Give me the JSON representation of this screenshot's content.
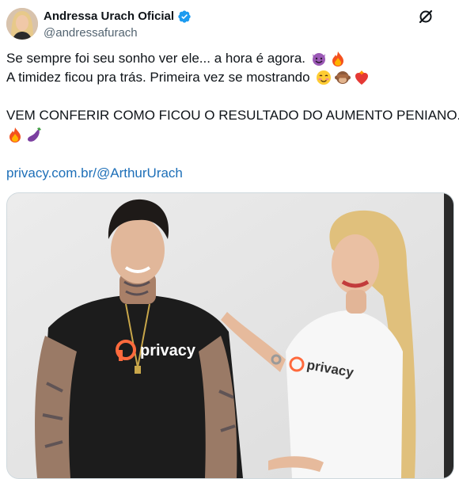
{
  "author": {
    "display_name": "Andressa Urach Oficial",
    "handle": "@andressafurach",
    "verified_icon": "verified-badge-icon",
    "avatar_icon": "avatar-photo"
  },
  "menu_icon": "grok-slash-icon",
  "tweet": {
    "line1": "Se sempre foi seu sonho ver ele... a hora é agora.",
    "line2": "A timidez ficou pra trás. Primeira vez se mostrando",
    "line3": "VEM CONFERIR COMO FICOU O RESULTADO DO AUMENTO PENIANO.",
    "link": "privacy.com.br/@ArthurUrach",
    "line1_emojis": [
      "smiling-devil-emoji",
      "fire-emoji"
    ],
    "line2_emojis": [
      "smiling-blush-emoji",
      "see-no-evil-monkey-emoji",
      "heart-on-fire-emoji"
    ],
    "line3_emojis": [
      "fire-emoji",
      "eggplant-emoji"
    ]
  },
  "media": {
    "shirt_left": "privacy",
    "shirt_right": "privacy",
    "accent": "#ff6a3d"
  },
  "colors": {
    "verified": "#1d9bf0",
    "link": "#1d6fb8",
    "handle": "#536471"
  }
}
